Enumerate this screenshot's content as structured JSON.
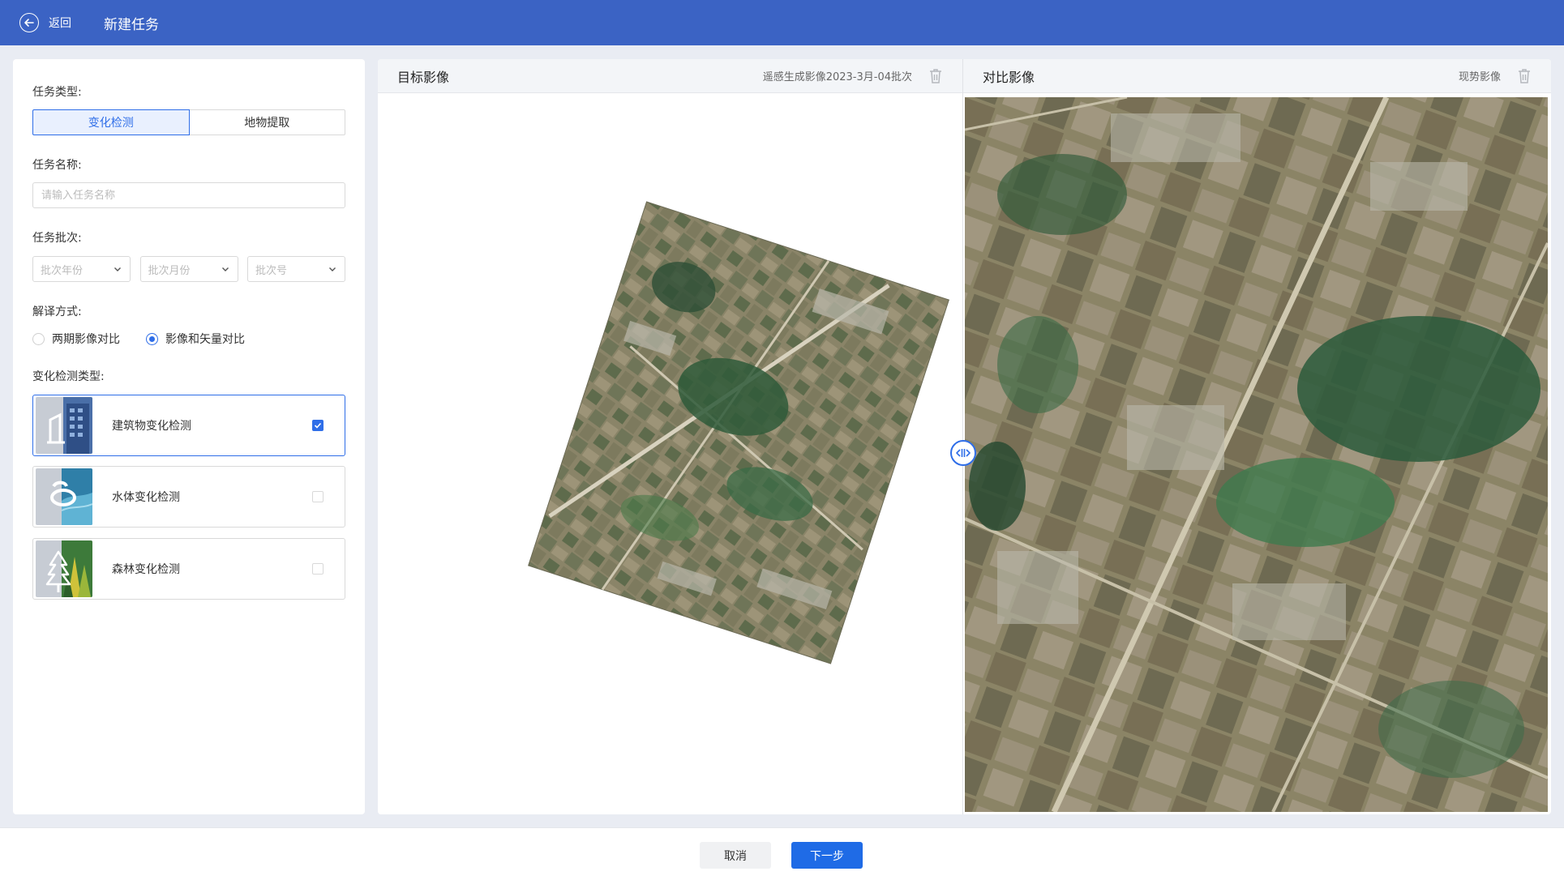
{
  "header": {
    "back_label": "返回",
    "title": "新建任务"
  },
  "form": {
    "task_type": {
      "label": "任务类型:",
      "options": [
        "变化检测",
        "地物提取"
      ],
      "selected": "变化检测"
    },
    "task_name": {
      "label": "任务名称:",
      "placeholder": "请输入任务名称",
      "value": ""
    },
    "task_batch": {
      "label": "任务批次:",
      "selects": [
        {
          "placeholder": "批次年份"
        },
        {
          "placeholder": "批次月份"
        },
        {
          "placeholder": "批次号"
        }
      ]
    },
    "interpret_mode": {
      "label": "解译方式:",
      "options": [
        "两期影像对比",
        "影像和矢量对比"
      ],
      "selected": "影像和矢量对比"
    },
    "detection_types": {
      "label": "变化检测类型:",
      "items": [
        {
          "label": "建筑物变化检测",
          "checked": true,
          "icon": "building-icon"
        },
        {
          "label": "水体变化检测",
          "checked": false,
          "icon": "water-icon"
        },
        {
          "label": "森林变化检测",
          "checked": false,
          "icon": "forest-icon"
        }
      ]
    }
  },
  "target_pane": {
    "title": "目标影像",
    "subtitle": "遥感生成影像2023-3月-04批次",
    "icon": "trash-icon"
  },
  "compare_pane": {
    "title": "对比影像",
    "subtitle": "现势影像",
    "icon": "trash-icon"
  },
  "footer": {
    "cancel_label": "取消",
    "next_label": "下一步"
  },
  "colors": {
    "header_bg": "#3b63c4",
    "accent": "#2f6ee8",
    "primary_button": "#1f6be6"
  }
}
